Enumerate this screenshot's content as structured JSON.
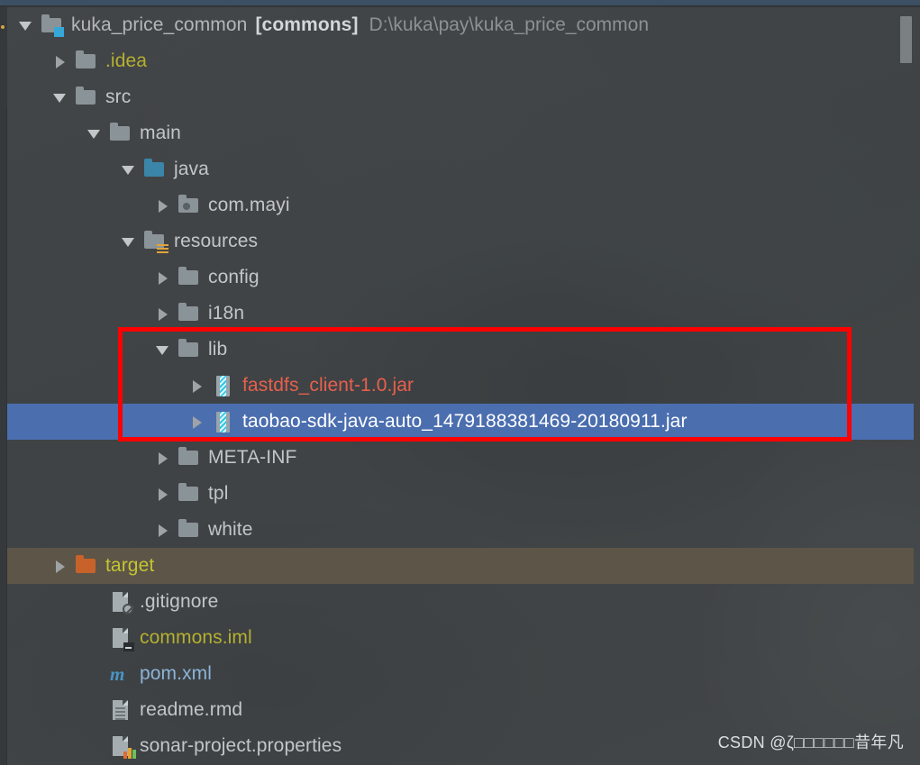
{
  "window": {
    "top_strip_color": "#3c4f63",
    "background_color": "#46494b",
    "selection_color": "#4b6eaf",
    "hover_color": "#5d5548",
    "annotation_color": "#fe0000"
  },
  "project_tree": {
    "root": {
      "name": "kuka_price_common",
      "module": "[commons]",
      "path": "D:\\kuka\\pay\\kuka_price_common",
      "icon": "project-folder-icon",
      "expanded": true
    },
    "rows": [
      {
        "label": ".idea",
        "icon": "folder-icon",
        "depth": 1,
        "twisty": "right",
        "color": "yellow",
        "state": "normal"
      },
      {
        "label": "src",
        "icon": "folder-icon",
        "depth": 1,
        "twisty": "down",
        "color": "white",
        "state": "normal"
      },
      {
        "label": "main",
        "icon": "folder-icon",
        "depth": 2,
        "twisty": "down",
        "color": "white",
        "state": "normal"
      },
      {
        "label": "java",
        "icon": "source-folder-icon",
        "depth": 3,
        "twisty": "down",
        "color": "white",
        "state": "normal"
      },
      {
        "label": "com.mayi",
        "icon": "package-icon",
        "depth": 4,
        "twisty": "right",
        "color": "white",
        "state": "normal"
      },
      {
        "label": "resources",
        "icon": "resource-folder-icon",
        "depth": 3,
        "twisty": "down",
        "color": "white",
        "state": "normal"
      },
      {
        "label": "config",
        "icon": "folder-icon",
        "depth": 4,
        "twisty": "right",
        "color": "white",
        "state": "normal"
      },
      {
        "label": "i18n",
        "icon": "folder-icon",
        "depth": 4,
        "twisty": "right",
        "color": "white",
        "state": "normal"
      },
      {
        "label": "lib",
        "icon": "folder-icon",
        "depth": 4,
        "twisty": "down",
        "color": "white",
        "state": "normal"
      },
      {
        "label": "fastdfs_client-1.0.jar",
        "icon": "jar-icon",
        "depth": 5,
        "twisty": "right",
        "color": "red",
        "state": "normal"
      },
      {
        "label": "taobao-sdk-java-auto_1479188381469-20180911.jar",
        "icon": "jar-icon",
        "depth": 5,
        "twisty": "right",
        "color": "white",
        "state": "selected"
      },
      {
        "label": "META-INF",
        "icon": "folder-icon",
        "depth": 4,
        "twisty": "right",
        "color": "white",
        "state": "normal"
      },
      {
        "label": "tpl",
        "icon": "folder-icon",
        "depth": 4,
        "twisty": "right",
        "color": "white",
        "state": "normal"
      },
      {
        "label": "white",
        "icon": "folder-icon",
        "depth": 4,
        "twisty": "right",
        "color": "white",
        "state": "normal"
      },
      {
        "label": "target",
        "icon": "excluded-folder-icon",
        "depth": 1,
        "twisty": "right",
        "color": "olive",
        "state": "hover"
      },
      {
        "label": ".gitignore",
        "icon": "gitignore-file-icon",
        "depth": 2,
        "twisty": "none",
        "color": "white",
        "state": "normal"
      },
      {
        "label": "commons.iml",
        "icon": "iml-file-icon",
        "depth": 2,
        "twisty": "none",
        "color": "yellow",
        "state": "normal"
      },
      {
        "label": "pom.xml",
        "icon": "maven-file-icon",
        "depth": 2,
        "twisty": "none",
        "color": "blue",
        "state": "normal"
      },
      {
        "label": "readme.rmd",
        "icon": "text-file-icon",
        "depth": 2,
        "twisty": "none",
        "color": "white",
        "state": "normal"
      },
      {
        "label": "sonar-project.properties",
        "icon": "properties-file-icon",
        "depth": 2,
        "twisty": "none",
        "color": "white",
        "state": "normal"
      }
    ]
  },
  "annotation": {
    "name": "red-highlight-box",
    "encloses": [
      "lib",
      "fastdfs_client-1.0.jar",
      "taobao-sdk-java-auto_1479188381469-20180911.jar"
    ]
  },
  "scrollbar": {
    "orientation": "vertical",
    "position": "top"
  },
  "watermark": {
    "text": "CSDN @ζ□□□□□□昔年凡"
  }
}
